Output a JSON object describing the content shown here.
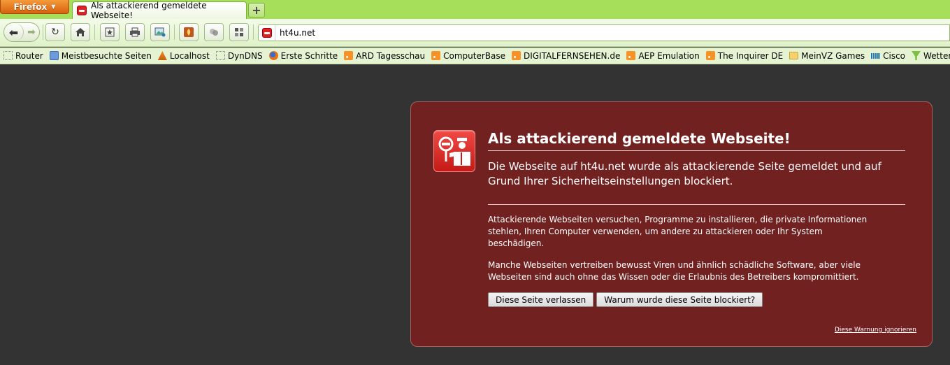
{
  "browser": {
    "app_button_label": "Firefox",
    "tab_title": "Als attackierend gemeldete Webseite!",
    "new_tab_label": "+",
    "url": "ht4u.net"
  },
  "bookmarks": [
    {
      "label": "Router",
      "icon": "blank-page-icon"
    },
    {
      "label": "Meistbesuchte Seiten",
      "icon": "smart-folder-icon"
    },
    {
      "label": "Localhost",
      "icon": "phpmyadmin-icon"
    },
    {
      "label": "DynDNS",
      "icon": "blank-page-icon"
    },
    {
      "label": "Erste Schritte",
      "icon": "firefox-icon"
    },
    {
      "label": "ARD Tagesschau",
      "icon": "rss-icon"
    },
    {
      "label": "ComputerBase",
      "icon": "rss-icon"
    },
    {
      "label": "DIGITALFERNSEHEN.de",
      "icon": "rss-icon"
    },
    {
      "label": "AEP Emulation",
      "icon": "rss-icon"
    },
    {
      "label": "The Inquirer DE",
      "icon": "rss-icon"
    },
    {
      "label": "MeinVZ Games",
      "icon": "folder-icon"
    },
    {
      "label": "Cisco",
      "icon": "cisco-icon"
    },
    {
      "label": "Wetter",
      "icon": "wetter-icon"
    }
  ],
  "warning": {
    "title": "Als attackierend gemeldete Webseite!",
    "short_desc": "Die Webseite auf ht4u.net wurde als attackierende Seite gemeldet und auf Grund Ihrer Sicherheitseinstellungen blockiert.",
    "long_desc_1": "Attackierende Webseiten versuchen, Programme zu installieren, die private Informationen stehlen, Ihren Computer verwenden, um andere zu attackieren oder Ihr System beschädigen.",
    "long_desc_2": "Manche Webseiten vertreiben bewusst Viren und ähnlich schädliche Software, aber viele Webseiten sind auch ohne das Wissen oder die Erlaubnis des Betreibers kompromittiert.",
    "leave_button": "Diese Seite verlassen",
    "why_button": "Warum wurde diese Seite blockiert?",
    "ignore_link": "Diese Warnung ignorieren"
  },
  "colors": {
    "page_bg": "#333333",
    "panel_bg": "#722121",
    "chrome_green": "#a6e05a",
    "firefox_orange": "#e8761c"
  }
}
